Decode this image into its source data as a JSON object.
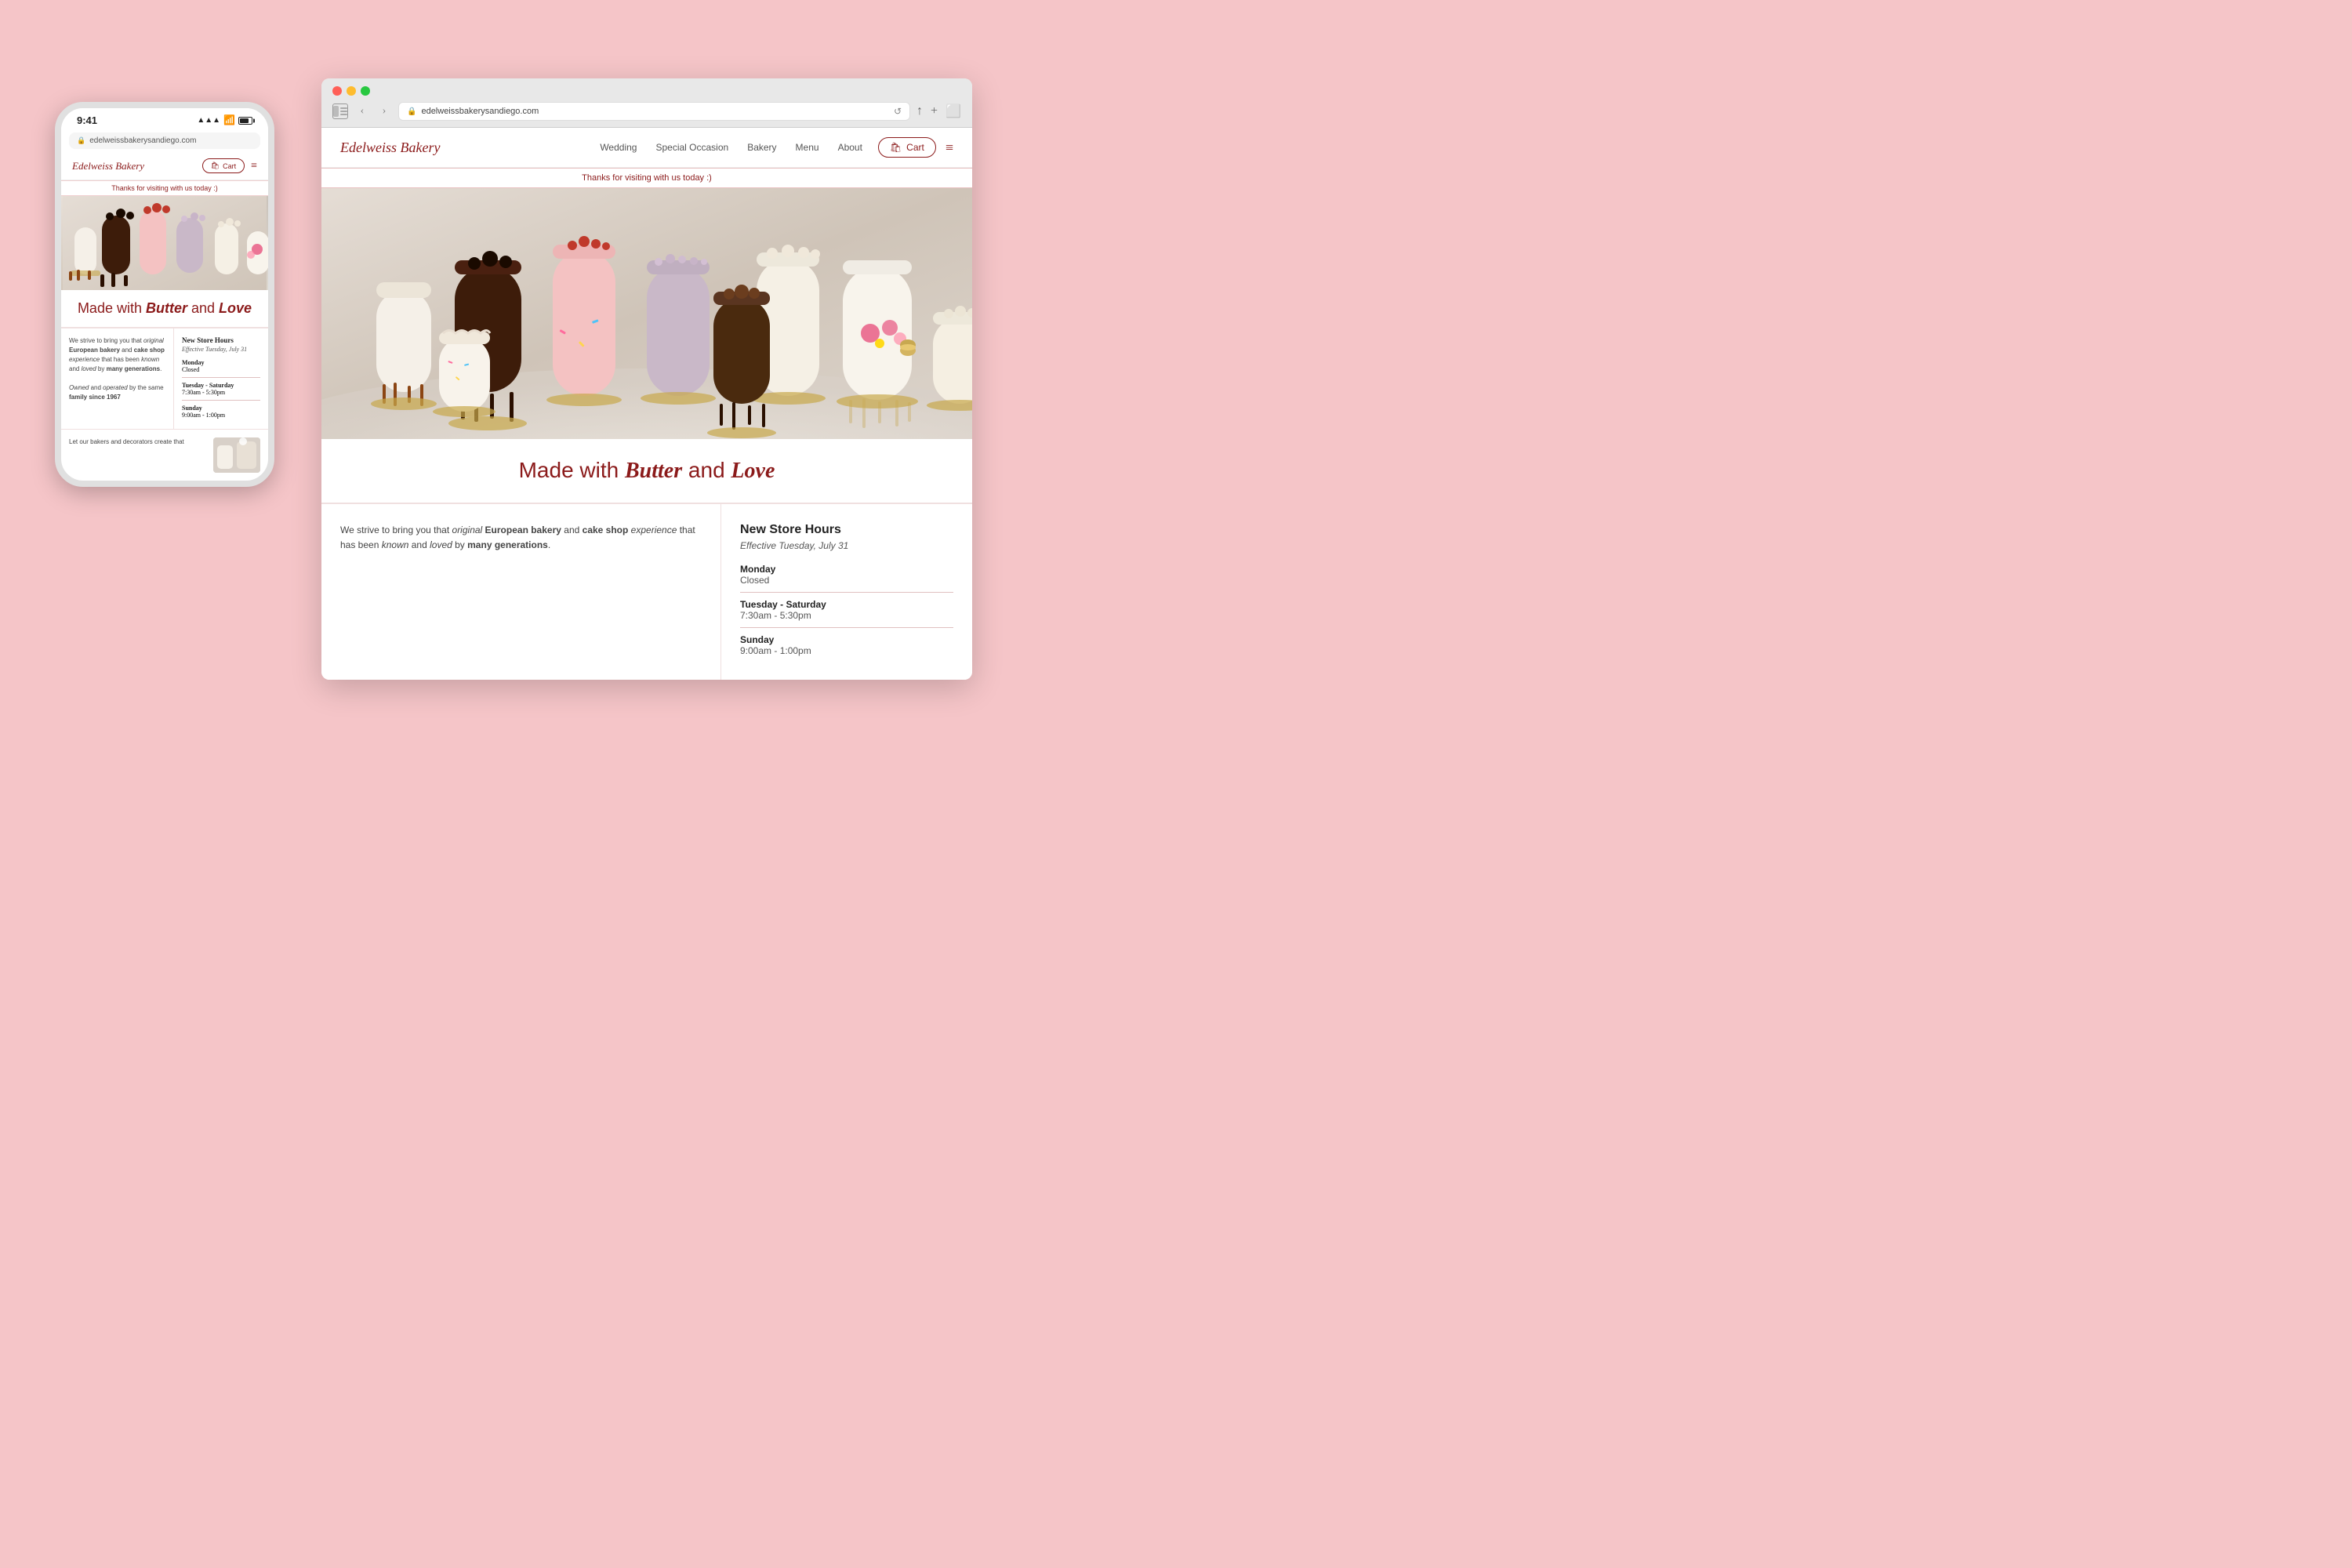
{
  "browser": {
    "url": "edelweissbakerysandiego.com",
    "traffic_lights": [
      "red",
      "yellow",
      "green"
    ]
  },
  "site": {
    "logo": "Edelweiss Bakery",
    "nav_links": [
      "Wedding",
      "Special Occasion",
      "Bakery",
      "Menu",
      "About"
    ],
    "cart_label": "Cart",
    "announcement": "Thanks for visiting with us today :)",
    "hero_title_plain": "Made with ",
    "hero_title_italic_bold": "Butter",
    "hero_title_and": " and ",
    "hero_title_italic2": "Love",
    "body_text_part1": "We strive to bring you that ",
    "body_text_italic1": "original",
    "body_text_bold1": " European bakery",
    "body_text_part2": " and ",
    "body_text_bold2": "cake shop",
    "body_text_italic2": " experience",
    "body_text_part3": " that has been ",
    "body_text_known": "known",
    "body_text_part4": " and ",
    "body_text_loved": "loved",
    "body_text_part5": " by ",
    "body_text_bold3": "many generations",
    "body_text_part6": ".",
    "store_hours": {
      "title": "New Store Hours",
      "subtitle": "Effective Tuesday, July 31",
      "monday_label": "Monday",
      "monday_hours": "Closed",
      "tue_sat_label": "Tuesday - Saturday",
      "tue_sat_hours": "7:30am - 5:30pm",
      "sunday_label": "Sunday",
      "sunday_hours": "9:00am - 1:00pm"
    }
  },
  "mobile": {
    "time": "9:41",
    "url": "edelweissbakerysandiego.com",
    "logo": "Edelweiss Bakery",
    "cart_label": "Cart",
    "announcement": "Thanks for visiting with us today :)",
    "hero_title_text": "Made with Butter and Love",
    "body_preview": "We strive to bring you that original European bakery and cake shop experience that has been known and loved by many generations.",
    "owned_text": "Owned and operated by the same family since 1967",
    "bottom_text": "Let our bakers and decorators create that",
    "hours_title": "New Store Hours",
    "hours_subtitle": "Effective Tuesday, July 31",
    "monday_label": "Monday",
    "monday_hours": "Closed",
    "tue_sat_label": "Tuesday - Saturday",
    "tue_sat_hours": "7:30am - 5:30pm",
    "sunday_label": "Sunday",
    "sunday_hours": "9:00am - 1:00pm"
  }
}
